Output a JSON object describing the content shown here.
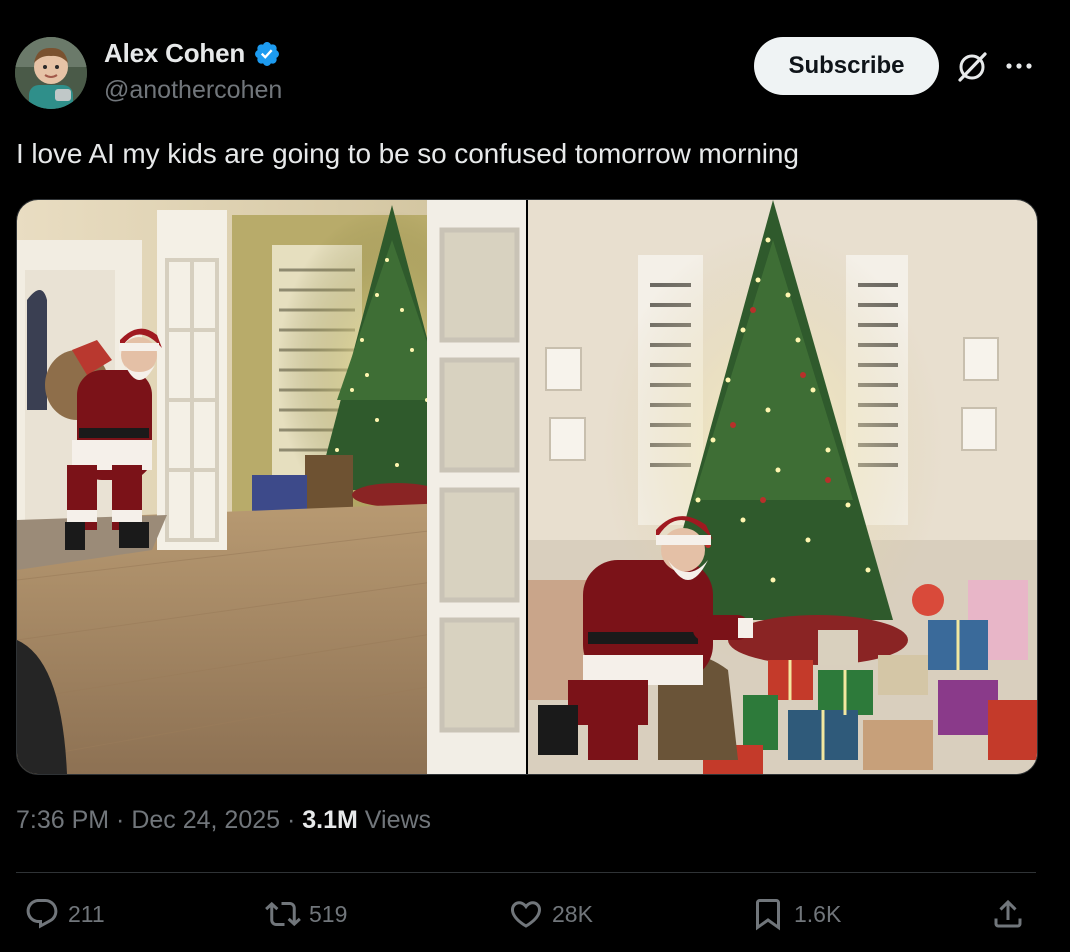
{
  "author": {
    "name": "Alex Cohen",
    "handle": "@anothercohen",
    "verified": true
  },
  "header": {
    "subscribe_label": "Subscribe",
    "icons": [
      "grok-icon",
      "more-icon"
    ]
  },
  "tweet": {
    "text": "I love AI my kids are going to be so confused tomorrow morning",
    "time": "7:36 PM",
    "sep1": " · ",
    "date": "Dec 24, 2025",
    "sep2": " · ",
    "views_count": "3.1M",
    "views_label": " Views"
  },
  "actions": {
    "replies": "211",
    "reposts": "519",
    "likes": "28K",
    "bookmarks": "1.6K"
  },
  "colors": {
    "background": "#000000",
    "text": "#e7e9ea",
    "muted": "#71767b",
    "verified_blue": "#1d9bf0",
    "subscribe_bg": "#eff3f4"
  }
}
